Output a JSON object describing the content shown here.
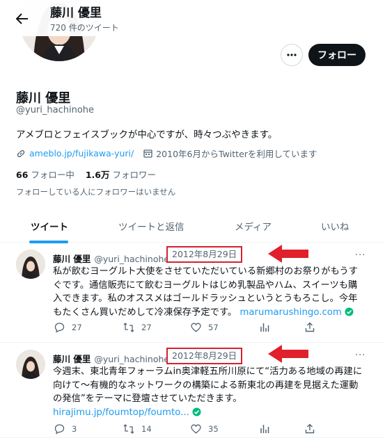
{
  "header": {
    "name": "藤川 優里",
    "tweet_count": "720 件のツイート"
  },
  "profile": {
    "name": "藤川 優里",
    "handle": "@yuri_hachinohe",
    "bio": "アメブロとフェイスブックが中心ですが、時々つぶやきます。",
    "website": "ameblo.jp/fujikawa-yuri/",
    "joined": "2010年6月からTwitterを利用しています",
    "following_count": "66",
    "following_label": "フォロー中",
    "followers_count": "1.6万",
    "followers_label": "フォロワー",
    "no_known_followers": "フォローしている人にフォロワーはいません",
    "follow_button": "フォロー"
  },
  "tabs": [
    {
      "label": "ツイート"
    },
    {
      "label": "ツイートと返信"
    },
    {
      "label": "メディア"
    },
    {
      "label": "いいね"
    }
  ],
  "tweets": [
    {
      "name": "藤川 優里",
      "handle": "@yuri_hachinohe",
      "date": "2012年8月29日",
      "lines": [
        "私が飲むヨーグルト大使をさせていただいている新郷村のお祭りがもうす",
        "ぐです。通信販売にて飲むヨーグルトはじめ乳製品やハム、スイーツも購",
        "入できます。私のオススメはゴールドラッシュというとうもろこし。今年",
        "もたくさん買いだめして冷凍保存予定です。"
      ],
      "link": "marumarushingo.com",
      "replies": "27",
      "retweets": "27",
      "likes": "57"
    },
    {
      "name": "藤川 優里",
      "handle": "@yuri_hachinohe",
      "date": "2012年8月29日",
      "lines": [
        "今週末、東北青年フォーラムin奥津軽五所川原にて“活力ある地域の再建に",
        "向けて～有機的なネットワークの構築による新東北の再建を見据えた運動",
        "の発信”をテーマに登壇させていただきます。"
      ],
      "link": "hirajimu.jp/foumtop/foumto...",
      "replies": "3",
      "retweets": "14",
      "likes": "35"
    }
  ],
  "colors": {
    "accent": "#1d9bf0",
    "highlight": "#d12430",
    "verified": "#00ba7c"
  }
}
